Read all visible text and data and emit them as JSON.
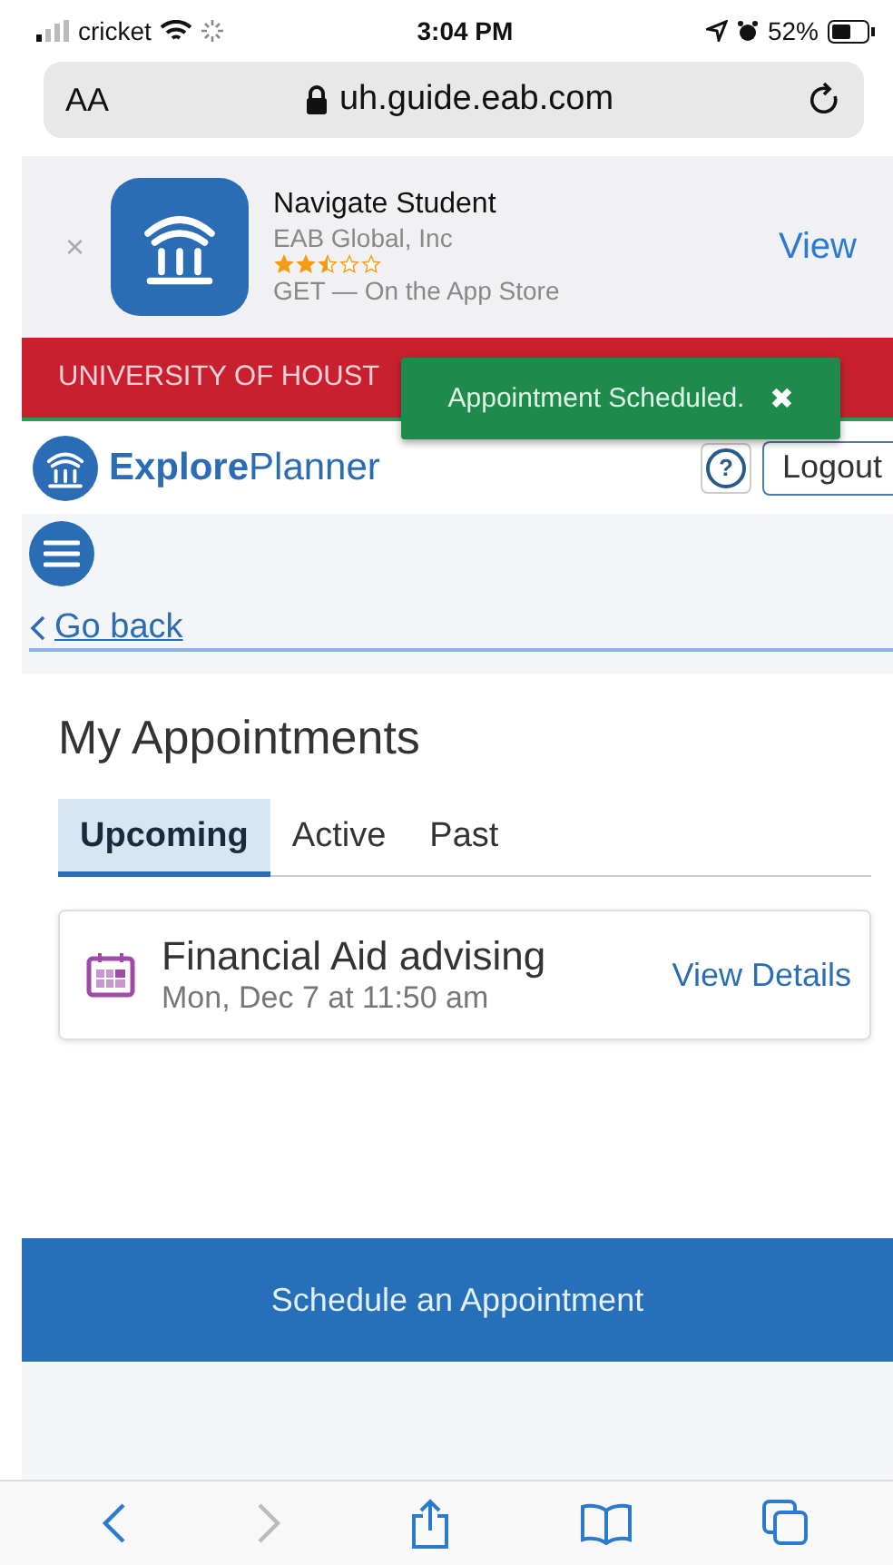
{
  "status_bar": {
    "carrier": "cricket",
    "time": "3:04 PM",
    "battery": "52%"
  },
  "browser": {
    "text_size": "AA",
    "url": "uh.guide.eab.com"
  },
  "app_banner": {
    "close": "×",
    "name": "Navigate Student",
    "publisher": "EAB Global, Inc",
    "stars": 2.5,
    "store": "GET — On the App Store",
    "action": "View"
  },
  "university_bar": {
    "title": "UNIVERSITY OF HOUST"
  },
  "toast": {
    "message": "Appointment Scheduled.",
    "close": "✖"
  },
  "header": {
    "brand_bold": "Explore",
    "brand_rest": "Planner",
    "help": "?",
    "logout": "Logout"
  },
  "go_back": "Go back",
  "page_title": "My Appointments",
  "tabs": [
    {
      "label": "Upcoming",
      "selected": true
    },
    {
      "label": "Active",
      "selected": false
    },
    {
      "label": "Past",
      "selected": false
    }
  ],
  "appointments": [
    {
      "title": "Financial Aid advising",
      "when": "Mon, Dec 7 at 11:50 am",
      "action": "View Details"
    }
  ],
  "schedule_button": "Schedule an Appointment",
  "toolbar": {
    "back_disabled": false,
    "forward_disabled": true
  }
}
